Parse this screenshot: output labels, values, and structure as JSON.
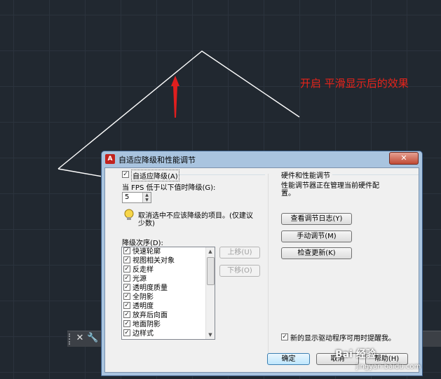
{
  "annotation": {
    "text": "开启 平滑显示后的效果",
    "color": "#e8231a"
  },
  "dialog": {
    "title": "自适应降级和性能调节",
    "close": "✕",
    "adaptive_checkbox": {
      "label": "自适应降级(A)",
      "checked": true
    },
    "fps_label": "当 FPS 低于以下值时降级(G):",
    "fps_value": "5",
    "tip_text_line1": "取消选中不应该降级的项目。(仅建议",
    "tip_text_line2": "少数)",
    "order_label": "降级次序(D):",
    "order_items": [
      {
        "label": "快速轮廓",
        "checked": true
      },
      {
        "label": "视图相关对象",
        "checked": true
      },
      {
        "label": "反走样",
        "checked": true
      },
      {
        "label": "光源",
        "checked": true
      },
      {
        "label": "透明度质量",
        "checked": true
      },
      {
        "label": "全阴影",
        "checked": true
      },
      {
        "label": "透明度",
        "checked": true
      },
      {
        "label": "放弃后向面",
        "checked": true
      },
      {
        "label": "地面阴影",
        "checked": true
      },
      {
        "label": "边样式",
        "checked": true
      }
    ],
    "move_up": "上移(U)",
    "move_down": "下移(O)",
    "hw_group_title": "硬件和性能调节",
    "hw_desc_line1": "性能调节器正在管理当前硬件配",
    "hw_desc_line2": "置。",
    "view_log": "查看调节日志(Y)",
    "manual_tune": "手动调节(M)",
    "check_updates": "检查更新(K)",
    "driver_notify": {
      "label": "新的显示驱动程序可用时提醒我。",
      "checked": true
    },
    "ok": "确定",
    "cancel": "取消",
    "help": "帮助(H)"
  },
  "command_bar": {
    "close_icon": "close-icon",
    "wrench_icon": "wrench-icon"
  },
  "watermark": {
    "brand": "Bai 经验",
    "url": "jingyan.baidu.com"
  }
}
